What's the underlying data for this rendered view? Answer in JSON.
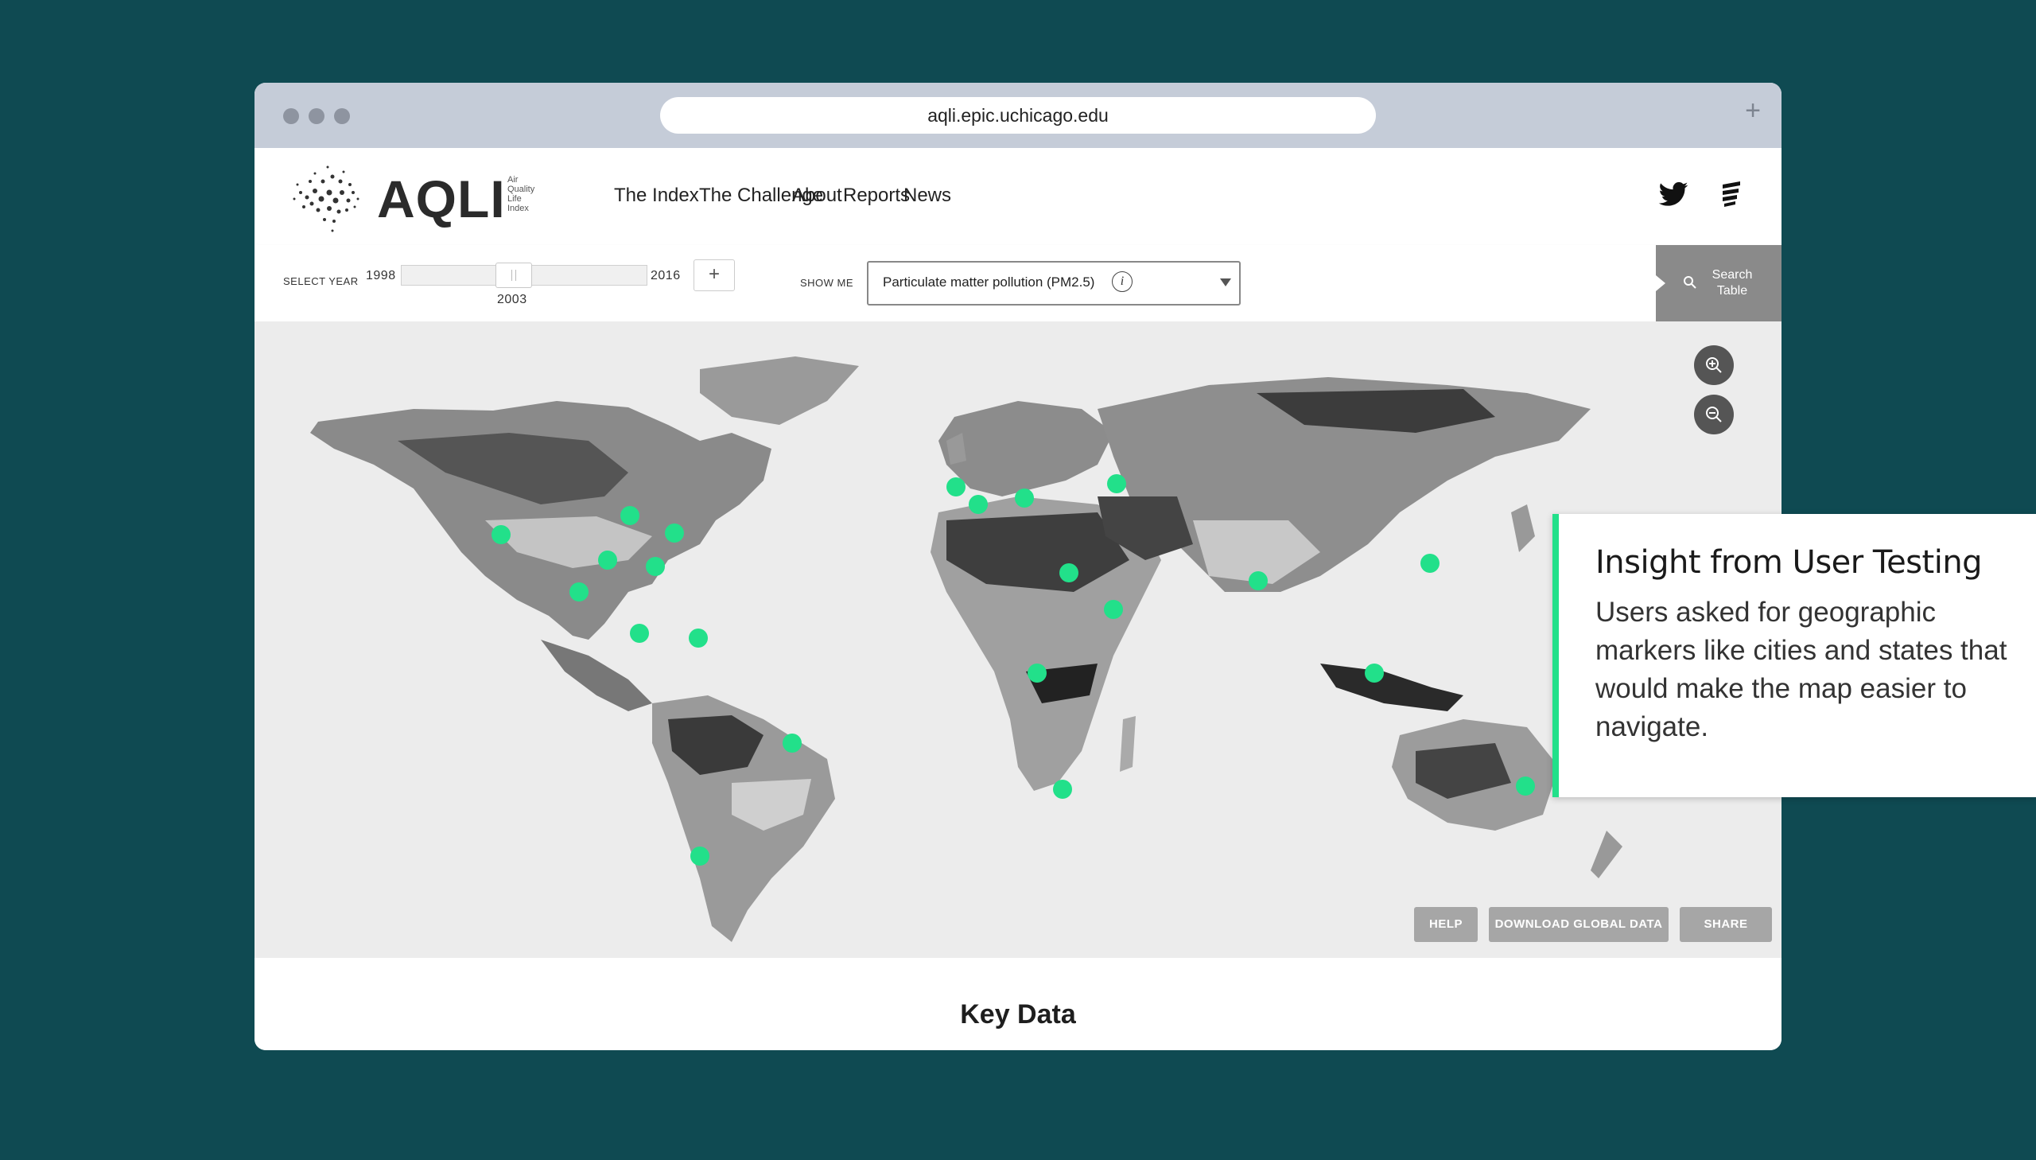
{
  "browser": {
    "url": "aqli.epic.uchicago.edu",
    "new_tab_icon": "plus-icon"
  },
  "nav": {
    "logo": "AQLI",
    "logo_sub": [
      "Air",
      "Quality",
      "Life",
      "Index"
    ],
    "items": [
      "The Index",
      "The Challenge",
      "About",
      "Reports",
      "News"
    ],
    "social": [
      "twitter-icon",
      "epic-logo-icon"
    ]
  },
  "controls": {
    "select_year_label": "SELECT YEAR",
    "year_min": "1998",
    "year_max": "2016",
    "year_selected": "2003",
    "year_value": 2003,
    "add_label": "+",
    "show_me_label": "SHOW ME",
    "metric_selected": "Particulate matter pollution (PM2.5)",
    "info_label": "i",
    "search_label": "Search Table"
  },
  "map": {
    "zoom_in_icon": "zoom-in-icon",
    "zoom_out_icon": "zoom-out-icon",
    "buttons": {
      "help": "HELP",
      "download": "DOWNLOAD GLOBAL DATA",
      "share": "SHARE"
    },
    "marker_color": "#22e08a"
  },
  "footer": {
    "heading": "Key Data"
  },
  "insight": {
    "title": "Insight from User Testing",
    "body": "Users asked for geographic markers like cities and states that would make the map easier to navigate."
  },
  "colors": {
    "background": "#0f4a52",
    "accent": "#22e08a",
    "map_bg": "#ececec"
  }
}
